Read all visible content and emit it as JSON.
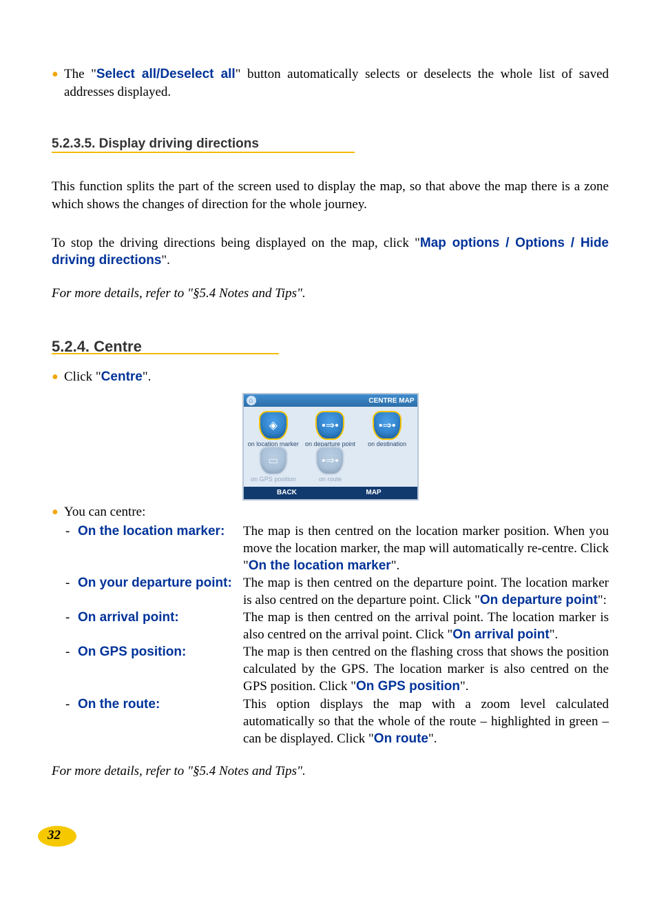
{
  "bullets": {
    "select_all": {
      "pre": "The \"",
      "term": "Select all/Deselect all",
      "post": "\" button automatically selects or deselects the whole list of saved addresses displayed."
    },
    "click_centre": {
      "pre": "Click \"",
      "term": "Centre",
      "post": "\"."
    },
    "you_can_centre": "You can centre:"
  },
  "headings": {
    "display_dir": "5.2.3.5. Display driving directions",
    "centre": "5.2.4. Centre"
  },
  "paras": {
    "split": "This function splits the part of the screen used to display the map, so that above the map there is a zone which shows the changes of direction for the whole journey.",
    "stop_pre": "To stop the driving directions being displayed on the map, click \"",
    "stop_term": "Map options / Options / Hide driving directions",
    "stop_post": "\".",
    "details": "For more details, refer to \"§5.4 Notes and Tips\"."
  },
  "device": {
    "title": "CENTRE MAP",
    "cells": {
      "loc": "on location marker",
      "dep": "on departure point",
      "dest": "on destination",
      "gps": "on GPS position",
      "route": "on route"
    },
    "back": "BACK",
    "map": "MAP"
  },
  "centre_items": [
    {
      "label": "On the location marker:",
      "desc_pre": "The map is then centred on the location marker position. When you move the location marker, the map will automatically re-centre. Click \"",
      "desc_term": "On the location marker",
      "desc_post": "\"."
    },
    {
      "label": "On your departure point:",
      "desc_pre": "The map is then centred on the departure point. The location marker is also centred on the departure point. Click \"",
      "desc_term": "On departure point",
      "desc_post": "\":"
    },
    {
      "label": "On arrival point:",
      "desc_pre": "The map is then centred on the arrival point. The location marker is also centred on the arrival point. Click \"",
      "desc_term": "On arrival point",
      "desc_post": "\"."
    },
    {
      "label": "On GPS position:",
      "desc_pre": "The map is then centred on the flashing cross that shows the position calculated by the GPS. The location marker is also centred on the GPS position. Click \"",
      "desc_term": "On GPS position",
      "desc_post": "\"."
    },
    {
      "label": "On the route:",
      "desc_pre": "This option displays the map with a zoom level calculated automatically so that the whole of the route – highlighted in green – can be displayed. Click \"",
      "desc_term": "On route",
      "desc_post": "\"."
    }
  ],
  "page_number": "32"
}
